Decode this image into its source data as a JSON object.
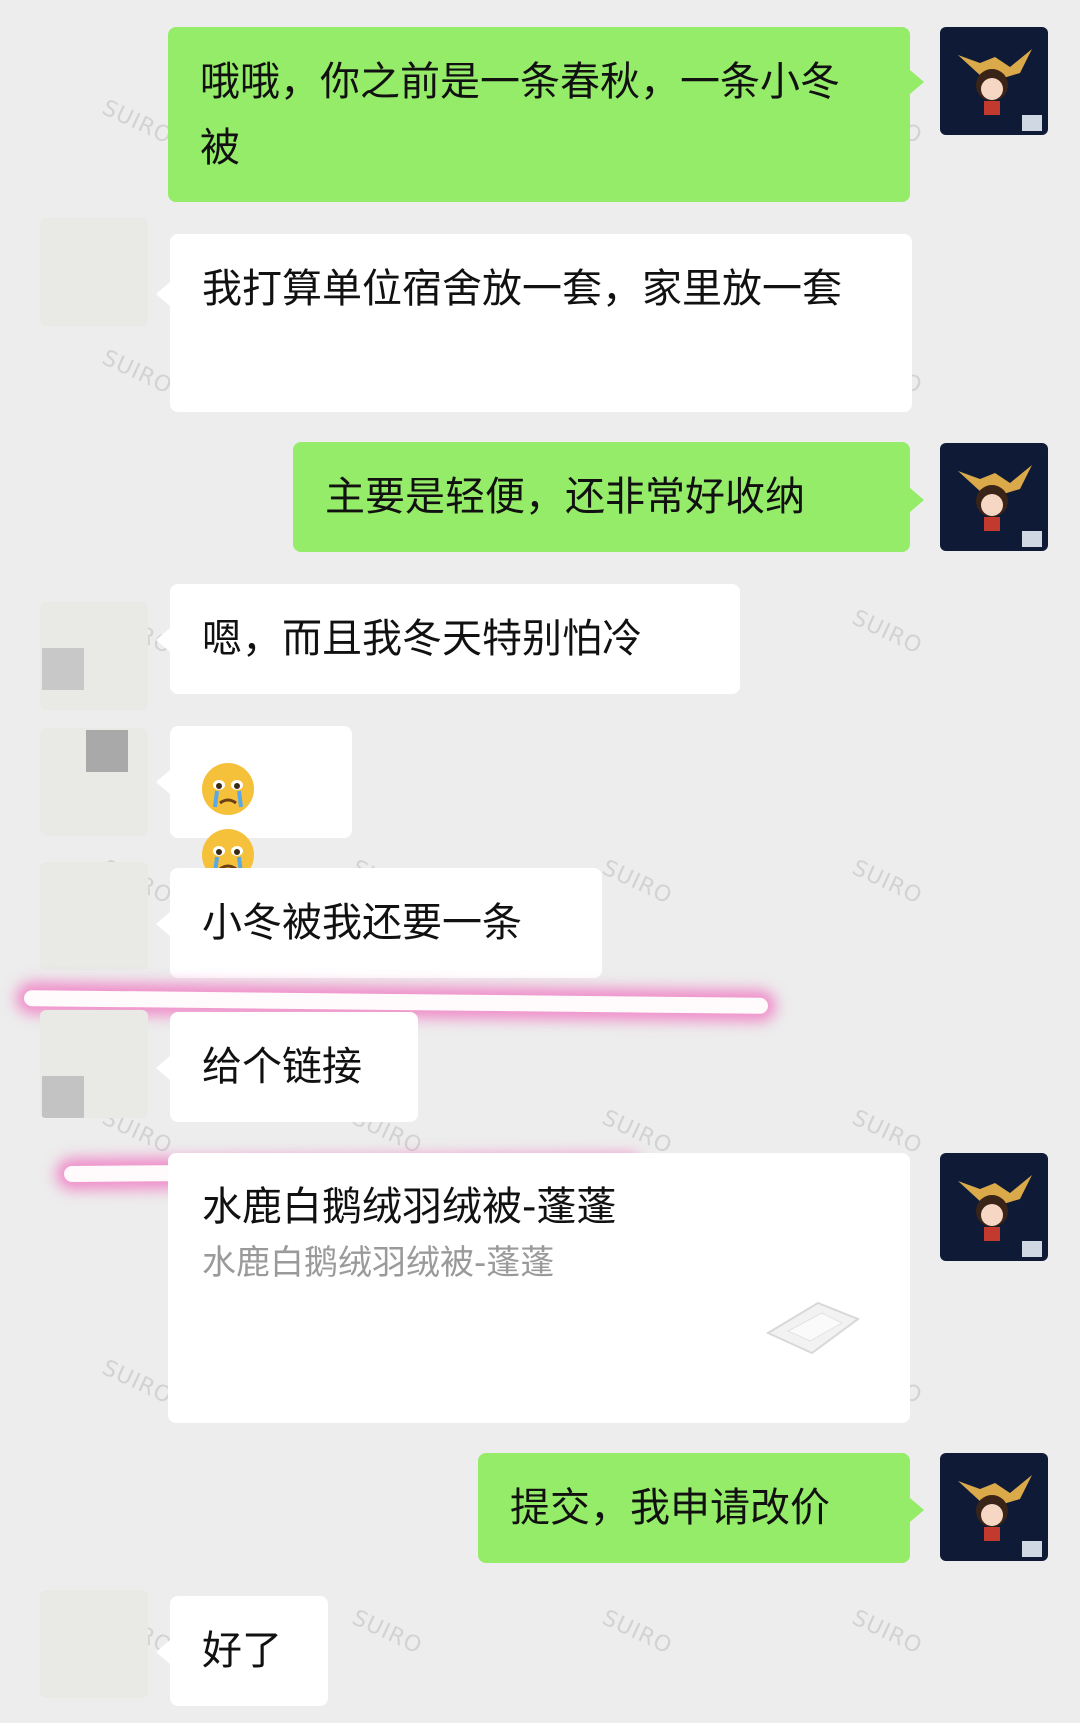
{
  "messages": [
    {
      "sender": "self",
      "text": "哦哦，你之前是一条春秋，一条小冬被"
    },
    {
      "sender": "other",
      "text": "我打算单位宿舍放一套，家里放一套"
    },
    {
      "sender": "self",
      "text": "主要是轻便，还非常好收纳"
    },
    {
      "sender": "other",
      "text": "嗯，而且我冬天特别怕冷"
    },
    {
      "sender": "other",
      "emoji": [
        "crying-face",
        "crying-face"
      ]
    },
    {
      "sender": "other",
      "text": "小冬被我还要一条"
    },
    {
      "sender": "other",
      "text": "给个链接"
    },
    {
      "sender": "self",
      "type": "link-card",
      "title": "水鹿白鹅绒羽绒被-蓬蓬",
      "subtitle": "水鹿白鹅绒羽绒被-蓬蓬"
    },
    {
      "sender": "self",
      "text": "提交，我申请改价"
    },
    {
      "sender": "other",
      "text": "好了"
    }
  ],
  "watermark": "SUIRO",
  "colors": {
    "self_bubble": "#95ec69",
    "other_bubble": "#ffffff",
    "background": "#ededed",
    "highlight": "#f06ebe"
  }
}
